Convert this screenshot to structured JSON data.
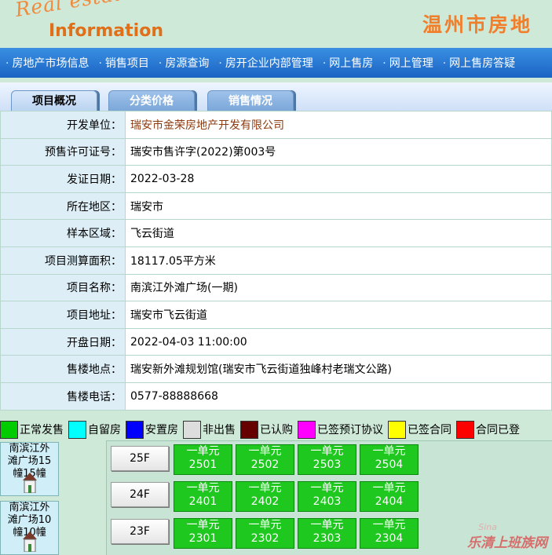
{
  "header": {
    "logo_top": "Real estate market",
    "logo_bottom": "Information",
    "site_title": "温州市房地"
  },
  "nav": {
    "items": [
      "房地产市场信息",
      "销售项目",
      "房源查询",
      "房开企业内部管理",
      "网上售房",
      "网上管理",
      "网上售房答疑"
    ]
  },
  "tabs": [
    "项目概况",
    "分类价格",
    "销售情况"
  ],
  "info_rows": [
    {
      "label": "开发单位：",
      "value": "瑞安市金荣房地产开发有限公司"
    },
    {
      "label": "预售许可证号：",
      "value": "瑞安市售许字(2022)第003号"
    },
    {
      "label": "发证日期：",
      "value": "2022-03-28"
    },
    {
      "label": "所在地区：",
      "value": "瑞安市"
    },
    {
      "label": "样本区域：",
      "value": "飞云街道"
    },
    {
      "label": "项目测算面积：",
      "value": "18117.05平方米"
    },
    {
      "label": "项目名称：",
      "value": "南滨江外滩广场(一期)"
    },
    {
      "label": "项目地址：",
      "value": "瑞安市飞云街道"
    },
    {
      "label": "开盘日期：",
      "value": "2022-04-03 11:00:00"
    },
    {
      "label": "售楼地点：",
      "value": "瑞安新外滩规划馆(瑞安市飞云街道独峰村老瑞文公路)"
    },
    {
      "label": "售楼电话：",
      "value": "0577-88888668"
    }
  ],
  "legend": [
    {
      "label": "正常发售",
      "color": "#00cc00"
    },
    {
      "label": "自留房",
      "color": "#00ffff"
    },
    {
      "label": "安置房",
      "color": "#0000ff"
    },
    {
      "label": "非出售",
      "color": "#dddddd"
    },
    {
      "label": "已认购",
      "color": "#660000"
    },
    {
      "label": "已签预订协议",
      "color": "#ff00ff"
    },
    {
      "label": "已签合同",
      "color": "#ffff00"
    },
    {
      "label": "合同已登",
      "color": "#ff0000"
    }
  ],
  "buildings": [
    {
      "line1": "南滨江外",
      "line2": "滩广场15",
      "line3": "幢15幢"
    },
    {
      "line1": "南滨江外",
      "line2": "滩广场10",
      "line3": "幢10幢"
    }
  ],
  "floors": [
    {
      "floor": "25F",
      "units": [
        {
          "name": "一单元",
          "no": "2501"
        },
        {
          "name": "一单元",
          "no": "2502"
        },
        {
          "name": "一单元",
          "no": "2503"
        },
        {
          "name": "一单元",
          "no": "2504"
        }
      ]
    },
    {
      "floor": "24F",
      "units": [
        {
          "name": "一单元",
          "no": "2401"
        },
        {
          "name": "一单元",
          "no": "2402"
        },
        {
          "name": "一单元",
          "no": "2403"
        },
        {
          "name": "一单元",
          "no": "2404"
        }
      ]
    },
    {
      "floor": "23F",
      "units": [
        {
          "name": "一单元",
          "no": "2301"
        },
        {
          "name": "一单元",
          "no": "2302"
        },
        {
          "name": "一单元",
          "no": "2303"
        },
        {
          "name": "一单元",
          "no": "2304"
        }
      ]
    }
  ],
  "watermark": {
    "main": "乐清上班族网",
    "small": "Sina"
  }
}
